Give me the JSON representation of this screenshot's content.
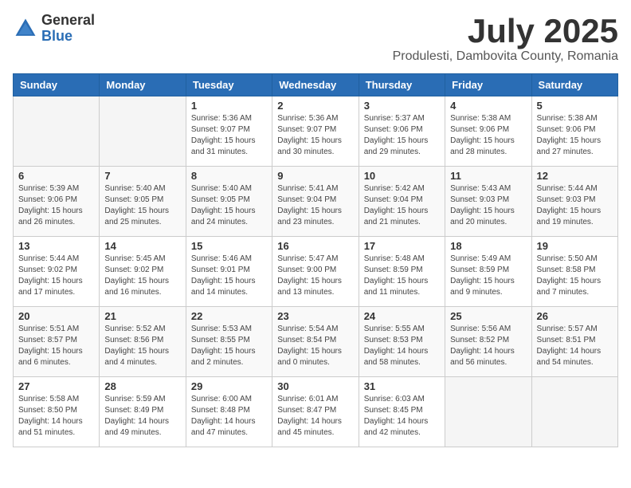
{
  "logo": {
    "general": "General",
    "blue": "Blue"
  },
  "header": {
    "title": "July 2025",
    "subtitle": "Produlesti, Dambovita County, Romania"
  },
  "weekdays": [
    "Sunday",
    "Monday",
    "Tuesday",
    "Wednesday",
    "Thursday",
    "Friday",
    "Saturday"
  ],
  "weeks": [
    [
      {
        "day": "",
        "info": ""
      },
      {
        "day": "",
        "info": ""
      },
      {
        "day": "1",
        "info": "Sunrise: 5:36 AM\nSunset: 9:07 PM\nDaylight: 15 hours\nand 31 minutes."
      },
      {
        "day": "2",
        "info": "Sunrise: 5:36 AM\nSunset: 9:07 PM\nDaylight: 15 hours\nand 30 minutes."
      },
      {
        "day": "3",
        "info": "Sunrise: 5:37 AM\nSunset: 9:06 PM\nDaylight: 15 hours\nand 29 minutes."
      },
      {
        "day": "4",
        "info": "Sunrise: 5:38 AM\nSunset: 9:06 PM\nDaylight: 15 hours\nand 28 minutes."
      },
      {
        "day": "5",
        "info": "Sunrise: 5:38 AM\nSunset: 9:06 PM\nDaylight: 15 hours\nand 27 minutes."
      }
    ],
    [
      {
        "day": "6",
        "info": "Sunrise: 5:39 AM\nSunset: 9:06 PM\nDaylight: 15 hours\nand 26 minutes."
      },
      {
        "day": "7",
        "info": "Sunrise: 5:40 AM\nSunset: 9:05 PM\nDaylight: 15 hours\nand 25 minutes."
      },
      {
        "day": "8",
        "info": "Sunrise: 5:40 AM\nSunset: 9:05 PM\nDaylight: 15 hours\nand 24 minutes."
      },
      {
        "day": "9",
        "info": "Sunrise: 5:41 AM\nSunset: 9:04 PM\nDaylight: 15 hours\nand 23 minutes."
      },
      {
        "day": "10",
        "info": "Sunrise: 5:42 AM\nSunset: 9:04 PM\nDaylight: 15 hours\nand 21 minutes."
      },
      {
        "day": "11",
        "info": "Sunrise: 5:43 AM\nSunset: 9:03 PM\nDaylight: 15 hours\nand 20 minutes."
      },
      {
        "day": "12",
        "info": "Sunrise: 5:44 AM\nSunset: 9:03 PM\nDaylight: 15 hours\nand 19 minutes."
      }
    ],
    [
      {
        "day": "13",
        "info": "Sunrise: 5:44 AM\nSunset: 9:02 PM\nDaylight: 15 hours\nand 17 minutes."
      },
      {
        "day": "14",
        "info": "Sunrise: 5:45 AM\nSunset: 9:02 PM\nDaylight: 15 hours\nand 16 minutes."
      },
      {
        "day": "15",
        "info": "Sunrise: 5:46 AM\nSunset: 9:01 PM\nDaylight: 15 hours\nand 14 minutes."
      },
      {
        "day": "16",
        "info": "Sunrise: 5:47 AM\nSunset: 9:00 PM\nDaylight: 15 hours\nand 13 minutes."
      },
      {
        "day": "17",
        "info": "Sunrise: 5:48 AM\nSunset: 8:59 PM\nDaylight: 15 hours\nand 11 minutes."
      },
      {
        "day": "18",
        "info": "Sunrise: 5:49 AM\nSunset: 8:59 PM\nDaylight: 15 hours\nand 9 minutes."
      },
      {
        "day": "19",
        "info": "Sunrise: 5:50 AM\nSunset: 8:58 PM\nDaylight: 15 hours\nand 7 minutes."
      }
    ],
    [
      {
        "day": "20",
        "info": "Sunrise: 5:51 AM\nSunset: 8:57 PM\nDaylight: 15 hours\nand 6 minutes."
      },
      {
        "day": "21",
        "info": "Sunrise: 5:52 AM\nSunset: 8:56 PM\nDaylight: 15 hours\nand 4 minutes."
      },
      {
        "day": "22",
        "info": "Sunrise: 5:53 AM\nSunset: 8:55 PM\nDaylight: 15 hours\nand 2 minutes."
      },
      {
        "day": "23",
        "info": "Sunrise: 5:54 AM\nSunset: 8:54 PM\nDaylight: 15 hours\nand 0 minutes."
      },
      {
        "day": "24",
        "info": "Sunrise: 5:55 AM\nSunset: 8:53 PM\nDaylight: 14 hours\nand 58 minutes."
      },
      {
        "day": "25",
        "info": "Sunrise: 5:56 AM\nSunset: 8:52 PM\nDaylight: 14 hours\nand 56 minutes."
      },
      {
        "day": "26",
        "info": "Sunrise: 5:57 AM\nSunset: 8:51 PM\nDaylight: 14 hours\nand 54 minutes."
      }
    ],
    [
      {
        "day": "27",
        "info": "Sunrise: 5:58 AM\nSunset: 8:50 PM\nDaylight: 14 hours\nand 51 minutes."
      },
      {
        "day": "28",
        "info": "Sunrise: 5:59 AM\nSunset: 8:49 PM\nDaylight: 14 hours\nand 49 minutes."
      },
      {
        "day": "29",
        "info": "Sunrise: 6:00 AM\nSunset: 8:48 PM\nDaylight: 14 hours\nand 47 minutes."
      },
      {
        "day": "30",
        "info": "Sunrise: 6:01 AM\nSunset: 8:47 PM\nDaylight: 14 hours\nand 45 minutes."
      },
      {
        "day": "31",
        "info": "Sunrise: 6:03 AM\nSunset: 8:45 PM\nDaylight: 14 hours\nand 42 minutes."
      },
      {
        "day": "",
        "info": ""
      },
      {
        "day": "",
        "info": ""
      }
    ]
  ]
}
